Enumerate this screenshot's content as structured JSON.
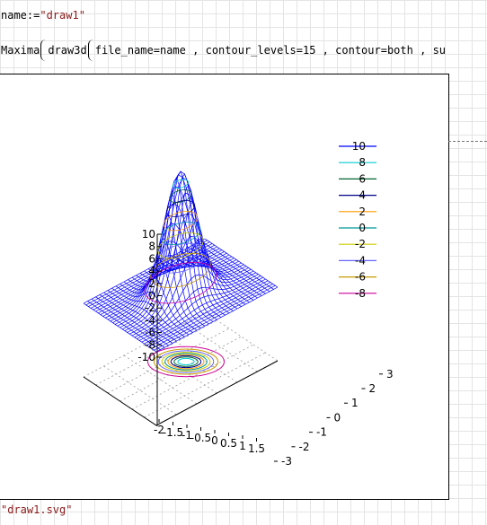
{
  "cell1": {
    "var": "name",
    "op": ":=",
    "value": "\"draw1\""
  },
  "cell2": {
    "func": "Maxima",
    "call": "draw3d",
    "args": "file_name",
    "eq": "=",
    "arg_val": "name",
    "sep1": ",",
    "opt1": "contour_levels",
    "opt1_val": "15",
    "sep2": ",",
    "opt2": "contour",
    "opt2_val": "both",
    "sep3": ",",
    "trailing": "su"
  },
  "result": "\"draw1.svg\"",
  "chart_data": {
    "type": "surface",
    "xlim": [
      -3,
      3
    ],
    "ylim": [
      -3,
      3
    ],
    "zlim": [
      -10,
      10
    ],
    "z_ticks": [
      "10",
      "8",
      "6",
      "4",
      "2",
      "0",
      "-2",
      "-4",
      "-6",
      "-8",
      "-10"
    ],
    "x_ticks": [
      "-2",
      "-1.5",
      "-1",
      "-0.5",
      "0",
      "0.5",
      "1",
      "1.5"
    ],
    "y_ticks": [
      "-3",
      "-2",
      "-1",
      "0",
      "1",
      "2",
      "3"
    ],
    "legend": [
      {
        "label": "10",
        "color": "#0000ff"
      },
      {
        "label": "8",
        "color": "#00cccc"
      },
      {
        "label": "6",
        "color": "#006633"
      },
      {
        "label": "4",
        "color": "#000088"
      },
      {
        "label": "2",
        "color": "#ff9900"
      },
      {
        "label": "0",
        "color": "#009999"
      },
      {
        "label": "-2",
        "color": "#cccc00"
      },
      {
        "label": "-4",
        "color": "#6666ff"
      },
      {
        "label": "-6",
        "color": "#cc9900"
      },
      {
        "label": "-8",
        "color": "#cc0099"
      }
    ],
    "surface_color": "#0000ff"
  }
}
